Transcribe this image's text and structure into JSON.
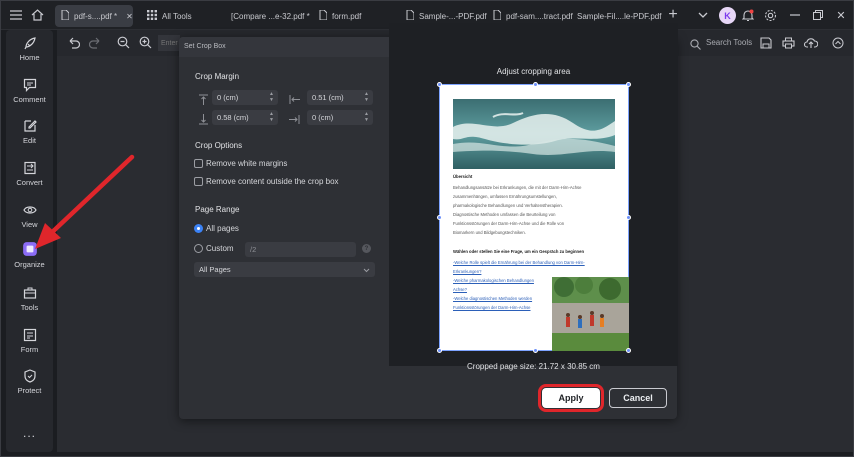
{
  "titlebar": {
    "tabs": [
      {
        "label": "pdf-s....pdf *"
      },
      {
        "label": "All Tools"
      },
      {
        "label": "[Compare ...e-32.pdf *"
      },
      {
        "label": "form.pdf"
      },
      {
        "label": "Sample-...-PDF.pdf"
      },
      {
        "label": "pdf-sam....tract.pdf"
      },
      {
        "label": "Sample-Fil....le-PDF.pdf"
      }
    ],
    "avatar_letter": "K"
  },
  "sidebar": {
    "items": [
      {
        "label": "Home",
        "icon": "rocket-icon"
      },
      {
        "label": "Comment",
        "icon": "comment-icon"
      },
      {
        "label": "Edit",
        "icon": "edit-icon"
      },
      {
        "label": "Convert",
        "icon": "convert-icon"
      },
      {
        "label": "View",
        "icon": "eye-icon"
      },
      {
        "label": "Organize",
        "icon": "organize-icon"
      },
      {
        "label": "Tools",
        "icon": "toolbox-icon"
      },
      {
        "label": "Form",
        "icon": "form-icon"
      },
      {
        "label": "Protect",
        "icon": "shield-icon"
      }
    ],
    "more": "..."
  },
  "toolbar": {
    "page_input_placeholder": "Enter",
    "search_label": "Search Tools"
  },
  "dialog": {
    "title": "Set Crop Box",
    "crop_margin": {
      "title": "Crop Margin",
      "top": "0 (cm)",
      "left": "0.51 (cm)",
      "bottom": "0.58 (cm)",
      "right": "0 (cm)"
    },
    "crop_options": {
      "title": "Crop Options",
      "remove_white_margins": "Remove white margins",
      "remove_outside": "Remove content outside the crop box"
    },
    "page_range": {
      "title": "Page Range",
      "all_pages": "All pages",
      "custom": "Custom",
      "custom_placeholder": "/2",
      "select_value": "All Pages"
    },
    "preview": {
      "title": "Adjust cropping area",
      "size_text": "Cropped page size: 21.72 x 30.85 cm"
    },
    "apply_label": "Apply",
    "cancel_label": "Cancel"
  },
  "page_content": {
    "heading": "Übersicht",
    "paragraph": [
      "Behandlungsansätze bei Erkrankungen, die mit der Darm-Hirn-Achse",
      "zusammenhängen, umfassen Ernährungsumstellungen,",
      "pharmakologische Behandlungen und Verhaltenstherapien.",
      "Diagnostische Methoden umfassen die Beurteilung von",
      "Funktionsstörungen der Darm-Hirn-Achse und die Rolle von",
      "Biomarkern und Bildgebungstechniken."
    ],
    "question": "Wählen oder stellen Sie eine Frage, um ein Gespräch zu beginnen",
    "links": [
      "-Welche Rolle spielt die Ernährung bei der Behandlung von Darm-Hirn-",
      "Erkrankungen?",
      "-Welche pharmakologischen Behandlungen",
      "Achse?",
      "-Welche diagnostischen Methoden werden",
      "Funktionsstörungen der Darm-Hirn-Achse"
    ]
  },
  "colors": {
    "annotation_red": "#e0262b",
    "accent_blue": "#3b82f6",
    "organize_purple": "#8b6cf6"
  }
}
